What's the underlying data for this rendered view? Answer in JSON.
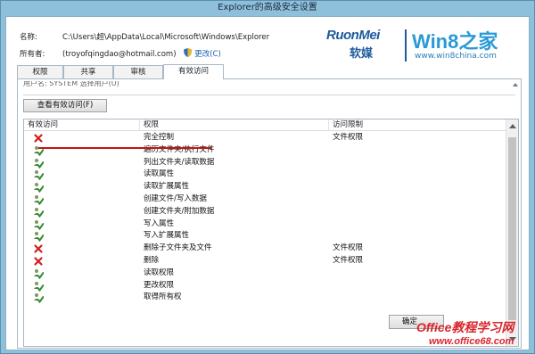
{
  "window": {
    "title": "Explorer的高级安全设置"
  },
  "info": {
    "name_label": "名称:",
    "name_value": "C:\\Users\\超\\AppData\\Local\\Microsoft\\Windows\\Explorer",
    "owner_label": "所有者:",
    "owner_value": "(troyofqingdao@hotmail.com)",
    "change_link": "更改(C)"
  },
  "logo": {
    "brand_en": "RuonMei",
    "brand_cn": "软媒",
    "product": "Win8之家",
    "url": "www.win8china.com"
  },
  "tabs": [
    {
      "label": "权限"
    },
    {
      "label": "共享"
    },
    {
      "label": "审核"
    },
    {
      "label": "有效访问"
    }
  ],
  "panel": {
    "cut_off_text": "用户名: SYSTEM  选择用户(U)",
    "view_button": "查看有效访问(F)"
  },
  "table": {
    "columns": [
      "有效访问",
      "权限",
      "访问限制"
    ],
    "rows": [
      {
        "access": "deny",
        "permission": "完全控制",
        "limit": "文件权限"
      },
      {
        "access": "allow",
        "permission": "遍历文件夹/执行文件",
        "limit": ""
      },
      {
        "access": "allow",
        "permission": "列出文件夹/读取数据",
        "limit": ""
      },
      {
        "access": "allow",
        "permission": "读取属性",
        "limit": ""
      },
      {
        "access": "allow",
        "permission": "读取扩展属性",
        "limit": ""
      },
      {
        "access": "allow",
        "permission": "创建文件/写入数据",
        "limit": ""
      },
      {
        "access": "allow",
        "permission": "创建文件夹/附加数据",
        "limit": ""
      },
      {
        "access": "allow",
        "permission": "写入属性",
        "limit": ""
      },
      {
        "access": "allow",
        "permission": "写入扩展属性",
        "limit": ""
      },
      {
        "access": "deny",
        "permission": "删除子文件夹及文件",
        "limit": "文件权限"
      },
      {
        "access": "deny",
        "permission": "删除",
        "limit": "文件权限"
      },
      {
        "access": "allow",
        "permission": "读取权限",
        "limit": ""
      },
      {
        "access": "allow",
        "permission": "更改权限",
        "limit": ""
      },
      {
        "access": "allow",
        "permission": "取得所有权",
        "limit": ""
      }
    ]
  },
  "footer": {
    "ok_button": "确定"
  },
  "watermark": {
    "text": "Office教程学习网",
    "url": "www.office68.com"
  },
  "colors": {
    "deny": "#d02020",
    "allow": "#2e8b2e",
    "annotation": "#c41414",
    "link": "#1a5fb4"
  }
}
